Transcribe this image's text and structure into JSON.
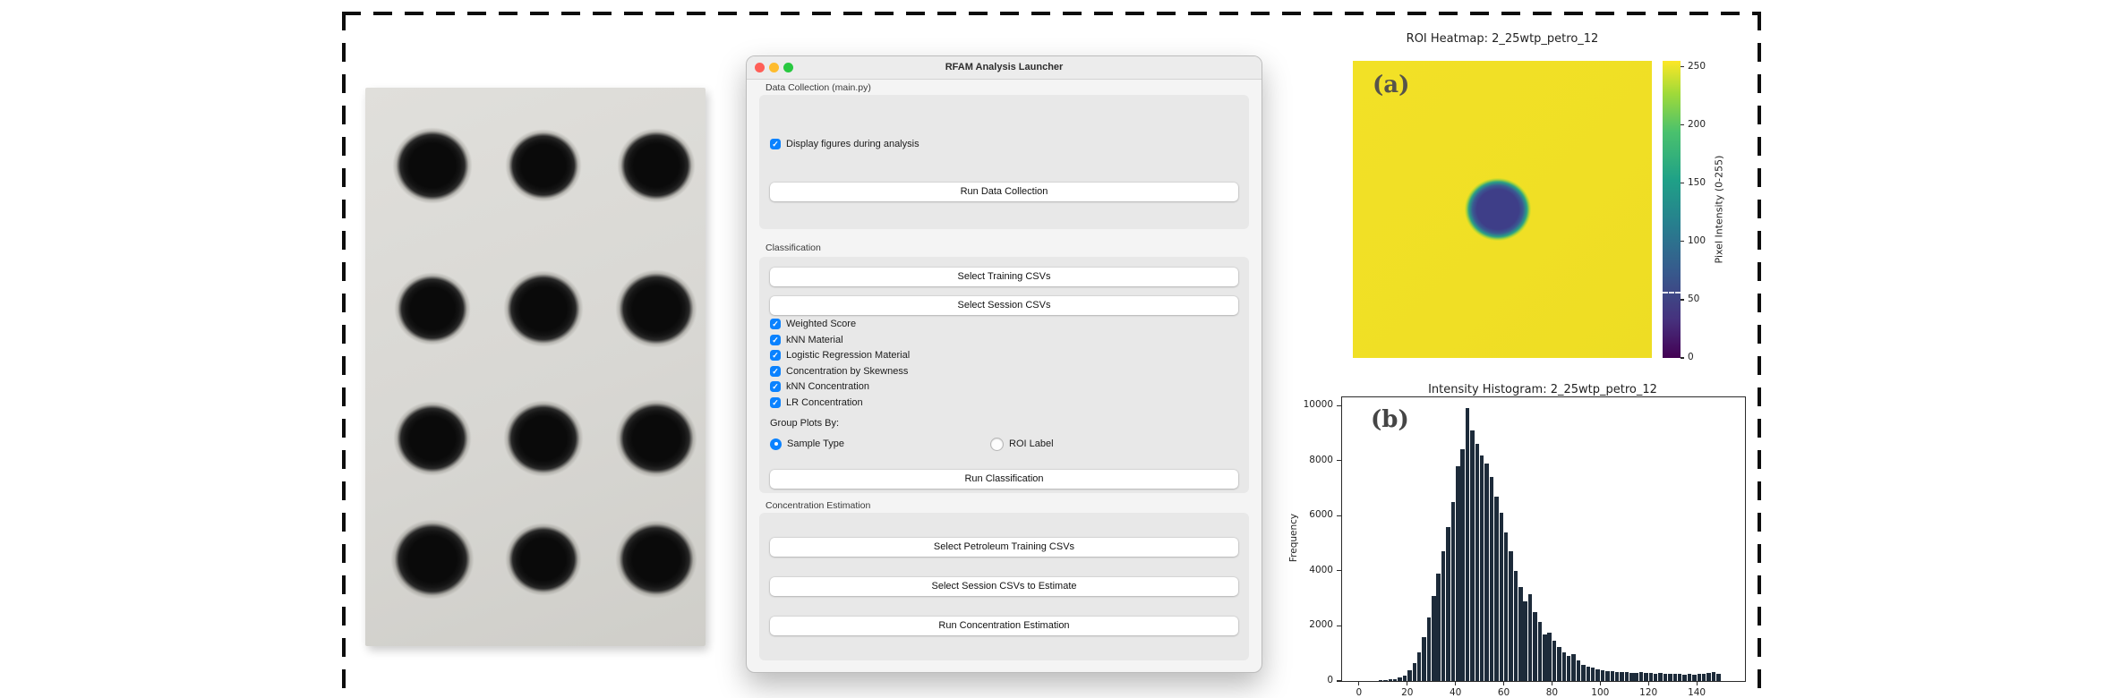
{
  "accent_color": "#0a82ff",
  "traffic_light_colors": {
    "close": "#ff5f57",
    "minimize": "#febc2e",
    "zoom": "#28c840"
  },
  "panel_labels": {
    "a": "(a)",
    "b": "(b)"
  },
  "specimen_photo": {
    "description": "Filter paper with black sample spots",
    "rows": 4,
    "cols": 3,
    "spot_count": 12
  },
  "launcher": {
    "window_title": "RFAM Analysis Launcher",
    "data_collection": {
      "section_label": "Data Collection (main.py)",
      "display_figures_checkbox": "Display figures during analysis",
      "run_button": "Run Data Collection"
    },
    "classification": {
      "section_label": "Classification",
      "select_training_button": "Select Training CSVs",
      "select_session_button": "Select Session CSVs",
      "checkboxes": [
        "Weighted Score",
        "kNN Material",
        "Logistic Regression Material",
        "Concentration by Skewness",
        "kNN Concentration",
        "LR Concentration"
      ],
      "group_plots_label": "Group Plots By:",
      "radio_sample_type": "Sample Type",
      "radio_roi_label": "ROI Label",
      "run_button": "Run Classification"
    },
    "concentration_estimation": {
      "section_label": "Concentration Estimation",
      "select_petroleum_button": "Select Petroleum Training CSVs",
      "select_session_button": "Select Session CSVs to Estimate",
      "run_button": "Run Concentration Estimation"
    }
  },
  "chart_data": [
    {
      "type": "heatmap",
      "title": "ROI Heatmap: 2_25wtp_petro_12",
      "colorbar_label": "Pixel Intensity (0-255)",
      "colorbar_ticks": [
        0,
        50,
        100,
        150,
        200,
        250
      ],
      "value_range": [
        0,
        255
      ],
      "colormap": "viridis",
      "background_intensity": 250,
      "spot_intensity": 45,
      "colorbar_marker_value": 57,
      "spot": {
        "center_x_frac": 0.485,
        "center_y_frac": 0.5,
        "radius_frac": 0.115
      }
    },
    {
      "type": "bar",
      "title": "Intensity Histogram: 2_25wtp_petro_12",
      "xlabel": "",
      "ylabel": "Frequency",
      "x_ticks": [
        0,
        20,
        40,
        60,
        80,
        100,
        120,
        140
      ],
      "y_ticks": [
        0,
        2000,
        4000,
        6000,
        8000,
        10000
      ],
      "xlim": [
        -7,
        160
      ],
      "ylim": [
        0,
        10300
      ],
      "bin_width": 2,
      "bin_start": 8,
      "bar_color": "#1d2b3a",
      "frequencies": [
        30,
        40,
        55,
        80,
        130,
        210,
        380,
        650,
        1050,
        1600,
        2300,
        3100,
        3900,
        4700,
        5600,
        6500,
        7800,
        8400,
        9900,
        9100,
        8600,
        8200,
        7900,
        7400,
        6700,
        6100,
        5400,
        4700,
        4000,
        3400,
        2900,
        3150,
        2500,
        2150,
        1700,
        1750,
        1450,
        1250,
        1050,
        900,
        980,
        750,
        600,
        530,
        480,
        430,
        400,
        370,
        350,
        330,
        310,
        330,
        300,
        290,
        310,
        280,
        290,
        270,
        280,
        260,
        270,
        250,
        260,
        240,
        250,
        230,
        270,
        250,
        290,
        310,
        260
      ]
    }
  ]
}
